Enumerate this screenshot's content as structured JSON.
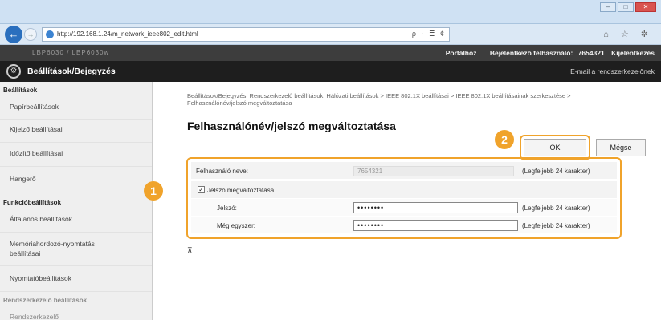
{
  "browser": {
    "url": "http://192.168.1.24/m_network_ieee802_edit.html",
    "address_tools": "ρ - ≣ ¢",
    "browser_icons": "⌂ ☆ ✲"
  },
  "topbar": {
    "model": "LBP6030 / LBP6030w",
    "portal_link": "Portálhoz",
    "login_user_label": "Bejelentkező felhasználó:",
    "login_user": "7654321",
    "logout_link": "Kijelentkezés"
  },
  "header": {
    "title": "Beállítások/Bejegyzés",
    "email_link": "E-mail a rendszerkezelőnek"
  },
  "sidebar": {
    "items": [
      {
        "label": "Beállítások",
        "kind": "head"
      },
      {
        "label": "Papírbeállítások",
        "kind": "item"
      },
      {
        "label": "Kijelző beállításai",
        "kind": "item"
      },
      {
        "label": "Időzítő beállításai",
        "kind": "item"
      },
      {
        "label": "Hangerő",
        "kind": "item"
      },
      {
        "label": "Funkcióbeállítások",
        "kind": "head"
      },
      {
        "label": "Általános beállítások",
        "kind": "item"
      },
      {
        "label": "Memóriahordozó-nyomtatás beállításai",
        "kind": "item"
      },
      {
        "label": "Nyomtatóbeállítások",
        "kind": "item"
      },
      {
        "label": "Rendszerkezelő beállítások",
        "kind": "muted"
      },
      {
        "label": "Rendszerkezelő",
        "kind": "muted"
      }
    ]
  },
  "main": {
    "breadcrumb": "Beállítások/Bejegyzés: Rendszerkezelő beállítások: Hálózati beállítások > IEEE 802.1X beállításai > IEEE 802.1X beállításainak szerkesztése > Felhasználónév/jelszó megváltoztatása",
    "title": "Felhasználónév/jelszó megváltoztatása",
    "ok_label": "OK",
    "cancel_label": "Mégse",
    "username_label": "Felhasználó neve:",
    "username_value": "7654321",
    "username_hint": "(Legfeljebb 24 karakter)",
    "change_pw_label": "Jelszó megváltoztatása",
    "change_pw_checked": "✓",
    "password_label": "Jelszó:",
    "password_value": "••••••••",
    "password_hint": "(Legfeljebb 24 karakter)",
    "confirm_label": "Még egyszer:",
    "confirm_value": "••••••••",
    "confirm_hint": "(Legfeljebb 24 karakter)",
    "to_top": "⊼"
  },
  "callouts": {
    "badge1": "1",
    "badge2": "2",
    "accent": "#f0a32b"
  }
}
